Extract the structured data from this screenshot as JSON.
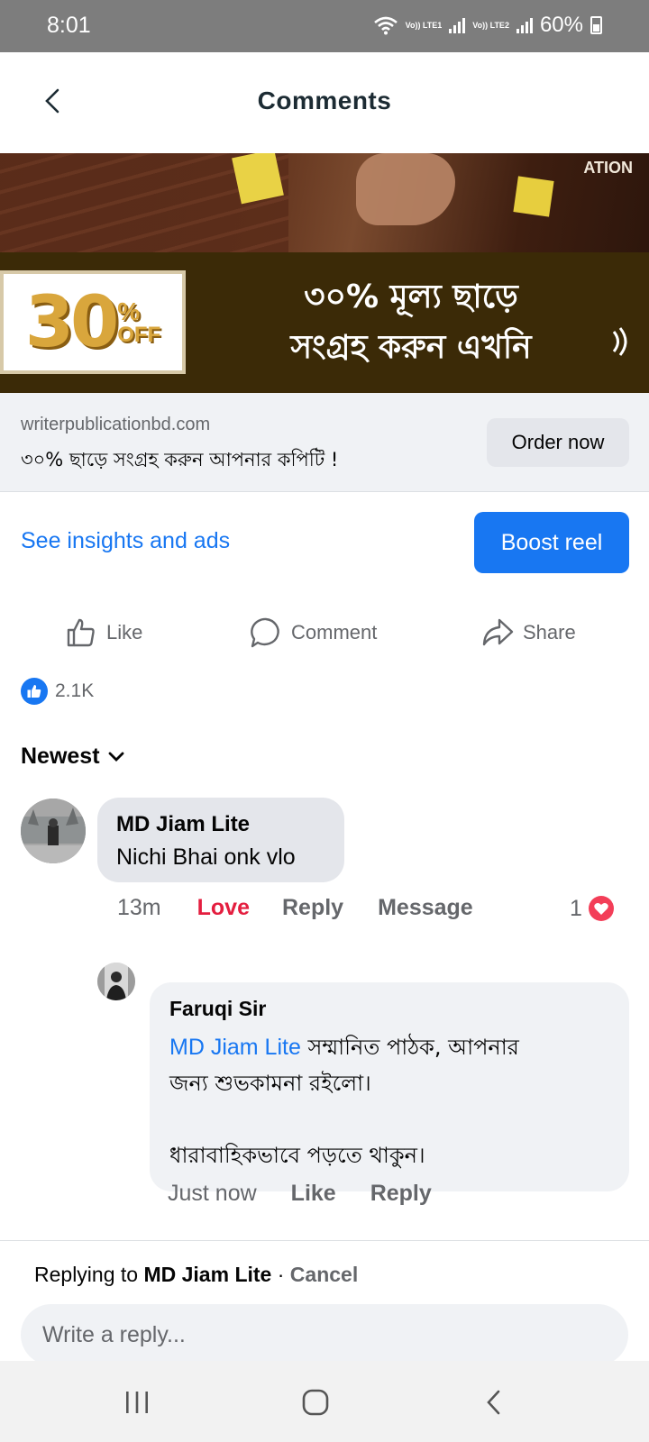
{
  "status_bar": {
    "time": "8:01",
    "battery": "60%",
    "net1": "Vo)) LTE1",
    "net2": "Vo)) LTE2"
  },
  "header": {
    "title": "Comments"
  },
  "ad": {
    "image_text_line1": "৩০% মূল্য ছাড়ে",
    "image_text_line2": "সংগ্রহ করুন এখনি",
    "off_number": "30",
    "off_percent": "%",
    "off_word": "OFF",
    "image_corner_text": "ATION",
    "domain": "writerpublicationbd.com",
    "tagline": "৩০% ছাড়ে সংগ্রহ করুন আপনার কপিটি !",
    "cta": "Order now"
  },
  "insights": {
    "link": "See insights and ads",
    "boost": "Boost reel"
  },
  "actions": {
    "like": "Like",
    "comment": "Comment",
    "share": "Share"
  },
  "reactions": {
    "count": "2.1K"
  },
  "sort": {
    "label": "Newest"
  },
  "comments": [
    {
      "author": "MD Jiam Lite",
      "text": "Nichi Bhai onk vlo",
      "time": "13m",
      "love": "Love",
      "reply": "Reply",
      "message": "Message",
      "reaction_count": "1",
      "replies": [
        {
          "author": "Faruqi Sir",
          "mention": "MD Jiam Lite",
          "text_line1": " সম্মানিত পাঠক, আপনার",
          "text_line2": "জন্য শুভকামনা রইলো।",
          "text_line3": "ধারাবাহিকভাবে পড়তে থাকুন।",
          "time": "Just now",
          "like": "Like",
          "reply": "Reply"
        }
      ]
    }
  ],
  "reply_bar": {
    "prefix": "Replying to ",
    "target": "MD Jiam Lite",
    "separator": " · ",
    "cancel": "Cancel",
    "placeholder": "Write a reply..."
  },
  "colors": {
    "accent": "#1877f2",
    "love": "#e41e3f",
    "muted": "#65676b"
  }
}
